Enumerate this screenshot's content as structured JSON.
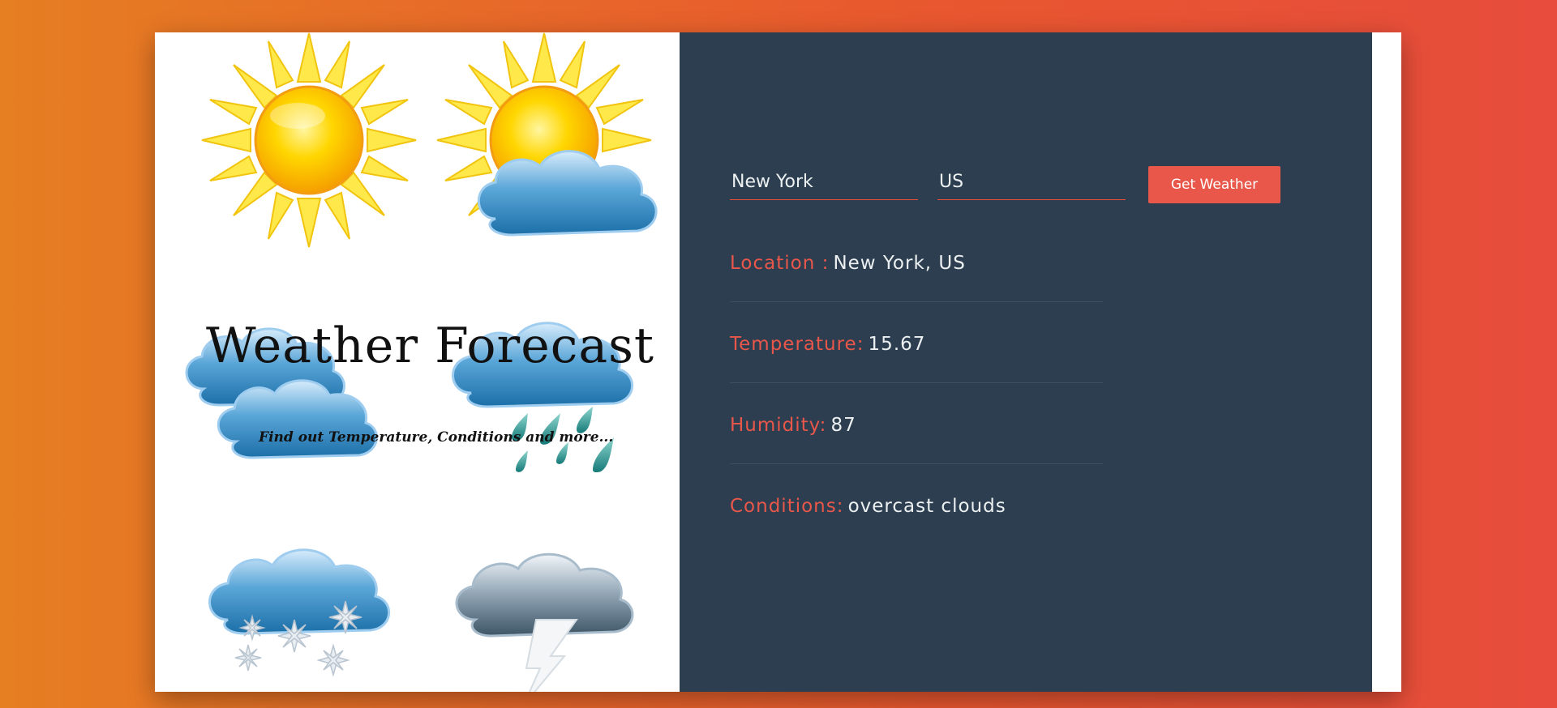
{
  "hero": {
    "title": "Weather Forecast",
    "subtitle": "Find out Temperature, Conditions and more..."
  },
  "form": {
    "city_value": "New York",
    "country_value": "US",
    "submit_label": "Get Weather"
  },
  "results": {
    "location_label": "Location :",
    "location_value": "New York, US",
    "temperature_label": "Temperature:",
    "temperature_value": "15.67",
    "humidity_label": "Humidity:",
    "humidity_value": "87",
    "conditions_label": "Conditions:",
    "conditions_value": "overcast clouds"
  },
  "colors": {
    "accent": "#e8574a",
    "panel": "#2c3e50",
    "text": "#ecf0f1"
  },
  "icons": [
    "sun-icon",
    "partly-cloudy-icon",
    "cloudy-icon",
    "rain-icon",
    "snow-icon",
    "thunderstorm-icon"
  ]
}
